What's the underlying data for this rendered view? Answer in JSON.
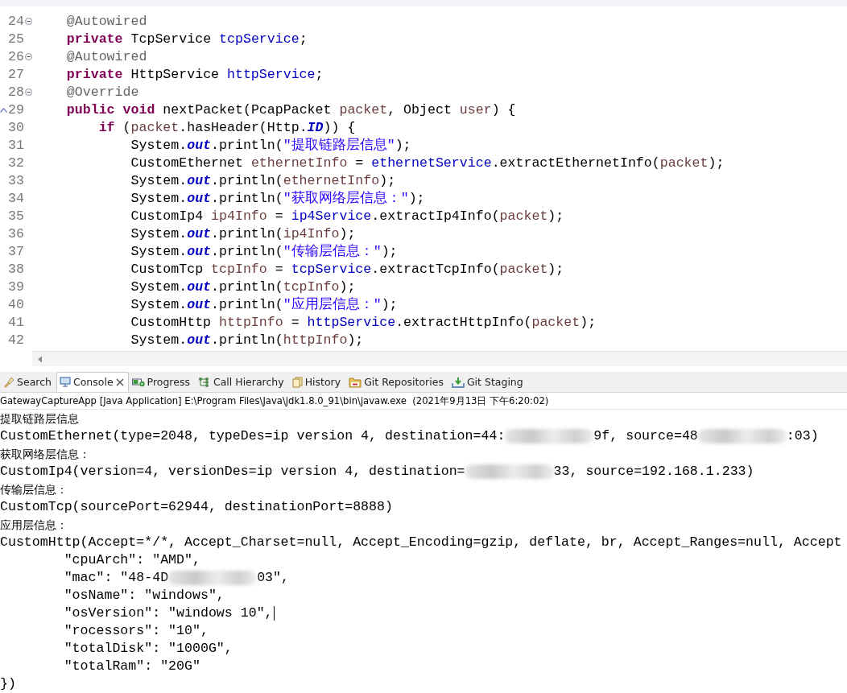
{
  "editor": {
    "lines": [
      {
        "number": "24",
        "fold": true,
        "override": false,
        "tokens": [
          {
            "kind": "ann",
            "t": "    @Autowired"
          }
        ]
      },
      {
        "number": "25",
        "fold": false,
        "override": false,
        "tokens": [
          {
            "kind": "kw",
            "t": "    private"
          },
          {
            "kind": "plain",
            "t": " TcpService "
          },
          {
            "kind": "field",
            "t": "tcpService"
          },
          {
            "kind": "plain",
            "t": ";"
          }
        ]
      },
      {
        "number": "26",
        "fold": true,
        "override": false,
        "tokens": [
          {
            "kind": "ann",
            "t": "    @Autowired"
          }
        ]
      },
      {
        "number": "27",
        "fold": false,
        "override": false,
        "tokens": [
          {
            "kind": "kw",
            "t": "    private"
          },
          {
            "kind": "plain",
            "t": " HttpService "
          },
          {
            "kind": "field",
            "t": "httpService"
          },
          {
            "kind": "plain",
            "t": ";"
          }
        ]
      },
      {
        "number": "28",
        "fold": true,
        "override": false,
        "tokens": [
          {
            "kind": "ann",
            "t": "    @Override"
          }
        ]
      },
      {
        "number": "29",
        "fold": false,
        "override": true,
        "tokens": [
          {
            "kind": "kw",
            "t": "    public"
          },
          {
            "kind": "kw",
            "t": " void"
          },
          {
            "kind": "plain",
            "t": " nextPacket(PcapPacket "
          },
          {
            "kind": "local",
            "t": "packet"
          },
          {
            "kind": "plain",
            "t": ", Object "
          },
          {
            "kind": "local",
            "t": "user"
          },
          {
            "kind": "plain",
            "t": ") {"
          }
        ]
      },
      {
        "number": "30",
        "fold": false,
        "override": false,
        "tokens": [
          {
            "kind": "kw",
            "t": "        if"
          },
          {
            "kind": "plain",
            "t": " ("
          },
          {
            "kind": "local",
            "t": "packet"
          },
          {
            "kind": "plain",
            "t": ".hasHeader(Http."
          },
          {
            "kind": "static",
            "t": "ID"
          },
          {
            "kind": "plain",
            "t": ")) {"
          }
        ]
      },
      {
        "number": "31",
        "fold": false,
        "override": false,
        "tokens": [
          {
            "kind": "plain",
            "t": "            System."
          },
          {
            "kind": "static",
            "t": "out"
          },
          {
            "kind": "plain",
            "t": ".println("
          },
          {
            "kind": "str",
            "t": "\"提取链路层信息\""
          },
          {
            "kind": "plain",
            "t": ");"
          }
        ]
      },
      {
        "number": "32",
        "fold": false,
        "override": false,
        "tokens": [
          {
            "kind": "plain",
            "t": "            CustomEthernet "
          },
          {
            "kind": "local",
            "t": "ethernetInfo"
          },
          {
            "kind": "plain",
            "t": " = "
          },
          {
            "kind": "field",
            "t": "ethernetService"
          },
          {
            "kind": "plain",
            "t": ".extractEthernetInfo("
          },
          {
            "kind": "local",
            "t": "packet"
          },
          {
            "kind": "plain",
            "t": ");"
          }
        ]
      },
      {
        "number": "33",
        "fold": false,
        "override": false,
        "tokens": [
          {
            "kind": "plain",
            "t": "            System."
          },
          {
            "kind": "static",
            "t": "out"
          },
          {
            "kind": "plain",
            "t": ".println("
          },
          {
            "kind": "local",
            "t": "ethernetInfo"
          },
          {
            "kind": "plain",
            "t": ");"
          }
        ]
      },
      {
        "number": "34",
        "fold": false,
        "override": false,
        "tokens": [
          {
            "kind": "plain",
            "t": "            System."
          },
          {
            "kind": "static",
            "t": "out"
          },
          {
            "kind": "plain",
            "t": ".println("
          },
          {
            "kind": "str",
            "t": "\"获取网络层信息：\""
          },
          {
            "kind": "plain",
            "t": ");"
          }
        ]
      },
      {
        "number": "35",
        "fold": false,
        "override": false,
        "tokens": [
          {
            "kind": "plain",
            "t": "            CustomIp4 "
          },
          {
            "kind": "local",
            "t": "ip4Info"
          },
          {
            "kind": "plain",
            "t": " = "
          },
          {
            "kind": "field",
            "t": "ip4Service"
          },
          {
            "kind": "plain",
            "t": ".extractIp4Info("
          },
          {
            "kind": "local",
            "t": "packet"
          },
          {
            "kind": "plain",
            "t": ");"
          }
        ]
      },
      {
        "number": "36",
        "fold": false,
        "override": false,
        "tokens": [
          {
            "kind": "plain",
            "t": "            System."
          },
          {
            "kind": "static",
            "t": "out"
          },
          {
            "kind": "plain",
            "t": ".println("
          },
          {
            "kind": "local",
            "t": "ip4Info"
          },
          {
            "kind": "plain",
            "t": ");"
          }
        ]
      },
      {
        "number": "37",
        "fold": false,
        "override": false,
        "tokens": [
          {
            "kind": "plain",
            "t": "            System."
          },
          {
            "kind": "static",
            "t": "out"
          },
          {
            "kind": "plain",
            "t": ".println("
          },
          {
            "kind": "str",
            "t": "\"传输层信息：\""
          },
          {
            "kind": "plain",
            "t": ");"
          }
        ]
      },
      {
        "number": "38",
        "fold": false,
        "override": false,
        "tokens": [
          {
            "kind": "plain",
            "t": "            CustomTcp "
          },
          {
            "kind": "local",
            "t": "tcpInfo"
          },
          {
            "kind": "plain",
            "t": " = "
          },
          {
            "kind": "field",
            "t": "tcpService"
          },
          {
            "kind": "plain",
            "t": ".extractTcpInfo("
          },
          {
            "kind": "local",
            "t": "packet"
          },
          {
            "kind": "plain",
            "t": ");"
          }
        ]
      },
      {
        "number": "39",
        "fold": false,
        "override": false,
        "tokens": [
          {
            "kind": "plain",
            "t": "            System."
          },
          {
            "kind": "static",
            "t": "out"
          },
          {
            "kind": "plain",
            "t": ".println("
          },
          {
            "kind": "local",
            "t": "tcpInfo"
          },
          {
            "kind": "plain",
            "t": ");"
          }
        ]
      },
      {
        "number": "40",
        "fold": false,
        "override": false,
        "tokens": [
          {
            "kind": "plain",
            "t": "            System."
          },
          {
            "kind": "static",
            "t": "out"
          },
          {
            "kind": "plain",
            "t": ".println("
          },
          {
            "kind": "str",
            "t": "\"应用层信息：\""
          },
          {
            "kind": "plain",
            "t": ");"
          }
        ]
      },
      {
        "number": "41",
        "fold": false,
        "override": false,
        "tokens": [
          {
            "kind": "plain",
            "t": "            CustomHttp "
          },
          {
            "kind": "local",
            "t": "httpInfo"
          },
          {
            "kind": "plain",
            "t": " = "
          },
          {
            "kind": "field",
            "t": "httpService"
          },
          {
            "kind": "plain",
            "t": ".extractHttpInfo("
          },
          {
            "kind": "local",
            "t": "packet"
          },
          {
            "kind": "plain",
            "t": ");"
          }
        ]
      },
      {
        "number": "42",
        "fold": false,
        "override": false,
        "tokens": [
          {
            "kind": "plain",
            "t": "            System."
          },
          {
            "kind": "static",
            "t": "out"
          },
          {
            "kind": "plain",
            "t": ".println("
          },
          {
            "kind": "local",
            "t": "httpInfo"
          },
          {
            "kind": "plain",
            "t": ");"
          }
        ]
      }
    ]
  },
  "tabs": [
    {
      "label": "Search",
      "selected": false,
      "closable": false
    },
    {
      "label": "Console",
      "selected": true,
      "closable": true
    },
    {
      "label": "Progress",
      "selected": false,
      "closable": false
    },
    {
      "label": "Call Hierarchy",
      "selected": false,
      "closable": false
    },
    {
      "label": "History",
      "selected": false,
      "closable": false
    },
    {
      "label": "Git Repositories",
      "selected": false,
      "closable": false
    },
    {
      "label": "Git Staging",
      "selected": false,
      "closable": false
    }
  ],
  "console": {
    "header": "GatewayCaptureApp [Java Application] E:\\Program Files\\Java\\jdk1.8.0_91\\bin\\javaw.exe  (2021年9月13日 下午6:20:02)",
    "lines": [
      {
        "kind": "cjk",
        "segments": [
          {
            "kind": "text",
            "t": "提取链路层信息"
          }
        ]
      },
      {
        "kind": "mono",
        "segments": [
          {
            "kind": "text",
            "t": "CustomEthernet(type=2048, typeDes=ip version 4, destination=44:"
          },
          {
            "kind": "redacted"
          },
          {
            "kind": "text",
            "t": "9f, source=48"
          },
          {
            "kind": "redacted"
          },
          {
            "kind": "text",
            "t": ":03)"
          }
        ]
      },
      {
        "kind": "cjk",
        "segments": [
          {
            "kind": "text",
            "t": "获取网络层信息："
          }
        ]
      },
      {
        "kind": "mono",
        "segments": [
          {
            "kind": "text",
            "t": "CustomIp4(version=4, versionDes=ip version 4, destination="
          },
          {
            "kind": "redacted"
          },
          {
            "kind": "text",
            "t": "33, source=192.168.1.233)"
          }
        ]
      },
      {
        "kind": "cjk",
        "segments": [
          {
            "kind": "text",
            "t": "传输层信息："
          }
        ]
      },
      {
        "kind": "mono",
        "segments": [
          {
            "kind": "text",
            "t": "CustomTcp(sourcePort=62944, destinationPort=8888)"
          }
        ]
      },
      {
        "kind": "cjk",
        "segments": [
          {
            "kind": "text",
            "t": "应用层信息："
          }
        ]
      },
      {
        "kind": "mono",
        "segments": [
          {
            "kind": "text",
            "t": "CustomHttp(Accept=*/*, Accept_Charset=null, Accept_Encoding=gzip, deflate, br, Accept_Ranges=null, Accept"
          }
        ]
      },
      {
        "kind": "mono",
        "segments": [
          {
            "kind": "text",
            "t": "        \"cpuArch\": \"AMD\","
          }
        ]
      },
      {
        "kind": "mono",
        "segments": [
          {
            "kind": "text",
            "t": "        \"mac\": \"48-4D"
          },
          {
            "kind": "redacted"
          },
          {
            "kind": "text",
            "t": "03\","
          }
        ]
      },
      {
        "kind": "mono",
        "segments": [
          {
            "kind": "text",
            "t": "        \"osName\": \"windows\","
          }
        ]
      },
      {
        "kind": "mono",
        "cursor": true,
        "segments": [
          {
            "kind": "text",
            "t": "        \"osVersion\": \"windows 10\","
          }
        ]
      },
      {
        "kind": "mono",
        "segments": [
          {
            "kind": "text",
            "t": "        \"rocessors\": \"10\","
          }
        ]
      },
      {
        "kind": "mono",
        "segments": [
          {
            "kind": "text",
            "t": "        \"totalDisk\": \"1000G\","
          }
        ]
      },
      {
        "kind": "mono",
        "segments": [
          {
            "kind": "text",
            "t": "        \"totalRam\": \"20G\""
          }
        ]
      },
      {
        "kind": "mono",
        "segments": [
          {
            "kind": "text",
            "t": "})"
          }
        ]
      }
    ]
  }
}
